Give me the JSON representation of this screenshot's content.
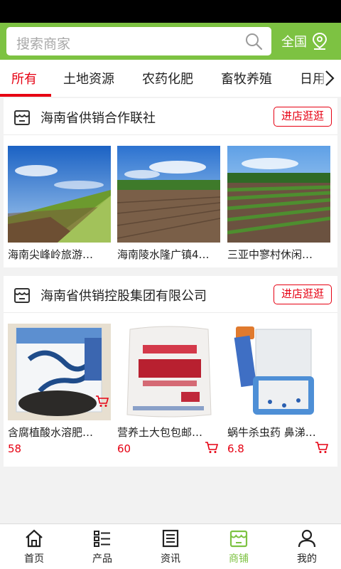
{
  "search": {
    "placeholder": "搜索商家"
  },
  "region": {
    "label": "全国"
  },
  "tabs": [
    {
      "label": "所有",
      "active": true
    },
    {
      "label": "土地资源"
    },
    {
      "label": "农药化肥"
    },
    {
      "label": "畜牧养殖"
    },
    {
      "label": "日用"
    }
  ],
  "shops": [
    {
      "name": "海南省供销合作联社",
      "visit_label": "进店逛逛",
      "products": [
        {
          "title": "海南尖峰岭旅游…",
          "image": "wheat-field-photo"
        },
        {
          "title": "海南陵水隆广镇4…",
          "image": "plowed-field-photo"
        },
        {
          "title": "三亚中寥村休闲…",
          "image": "crop-rows-photo"
        }
      ]
    },
    {
      "name": "海南省供销控股集团有限公司",
      "visit_label": "进店逛逛",
      "products": [
        {
          "title": "含腐植酸水溶肥…",
          "price": "58",
          "image": "fertilizer-bag-photo"
        },
        {
          "title": "营养土大包包邮…",
          "price": "60",
          "image": "soil-sack-photo"
        },
        {
          "title": "蜗牛杀虫药 鼻涕…",
          "price": "6.8",
          "image": "pesticide-bottle-photo"
        }
      ]
    }
  ],
  "bottom_nav": [
    {
      "label": "首页",
      "icon": "home-icon"
    },
    {
      "label": "产品",
      "icon": "list-icon"
    },
    {
      "label": "资讯",
      "icon": "news-icon"
    },
    {
      "label": "商铺",
      "icon": "shop-icon",
      "active": true
    },
    {
      "label": "我的",
      "icon": "user-icon"
    }
  ],
  "colors": {
    "brand_green": "#7dc242",
    "accent_red": "#e60012"
  }
}
